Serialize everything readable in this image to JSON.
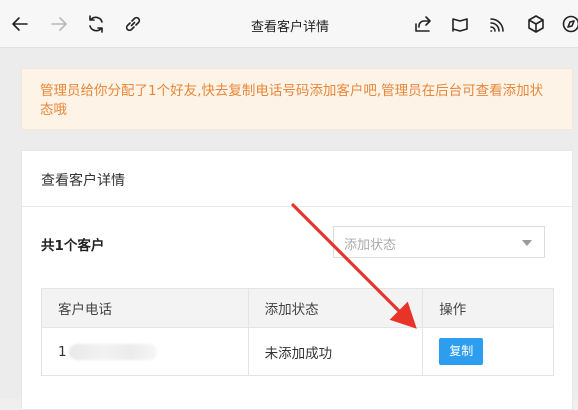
{
  "toolbar": {
    "title": "查看客户详情",
    "icons": [
      "back-arrow-icon",
      "forward-arrow-icon",
      "refresh-icon",
      "link-icon",
      "share-icon",
      "flag-icon",
      "cast-icon",
      "cube-icon",
      "compass-icon"
    ]
  },
  "notice": {
    "text": "管理员给你分配了1个好友,快去复制电话号码添加客户吧,管理员在后台可查看添加状态哦"
  },
  "card": {
    "title": "查看客户详情",
    "count_label": "共1个客户",
    "filter": {
      "placeholder": "添加状态"
    },
    "table": {
      "headers": [
        "客户电话",
        "添加状态",
        "操作"
      ],
      "rows": [
        {
          "phone_visible": "1",
          "status": "未添加成功",
          "action": "复制"
        }
      ]
    }
  },
  "colors": {
    "notice_text": "#e8873a",
    "notice_bg": "#fdf3e7",
    "button": "#2d9df0",
    "annotation_arrow": "#e8332a"
  }
}
